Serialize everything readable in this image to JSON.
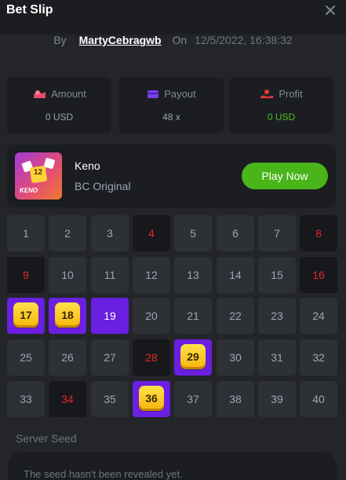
{
  "header": {
    "title": "Bet Slip",
    "close_icon": "close-icon"
  },
  "meta": {
    "by_label": "By",
    "username": "MartyCebragwb",
    "on_label": "On",
    "datetime": "12/5/2022, 16:38:32"
  },
  "stats": [
    {
      "label": "Amount",
      "value": "0 USD",
      "icon": "amount-icon",
      "color": "#e24a6a"
    },
    {
      "label": "Payout",
      "value": "48 x",
      "icon": "payout-icon",
      "color": "#7b3ff2"
    },
    {
      "label": "Profit",
      "value": "0 USD",
      "icon": "profit-icon",
      "color": "#e23a3a",
      "value_color": "#49c31b"
    }
  ],
  "game": {
    "name": "Keno",
    "subtitle": "BC Original",
    "play_label": "Play Now",
    "thumb_label": "KENO",
    "thumb_number": "12"
  },
  "grid": {
    "numbers": [
      "1",
      "2",
      "3",
      "4",
      "5",
      "6",
      "7",
      "8",
      "9",
      "10",
      "11",
      "12",
      "13",
      "14",
      "15",
      "16",
      "17",
      "18",
      "19",
      "20",
      "21",
      "22",
      "23",
      "24",
      "25",
      "26",
      "27",
      "28",
      "29",
      "30",
      "31",
      "32",
      "33",
      "34",
      "35",
      "36",
      "37",
      "38",
      "39",
      "40"
    ],
    "drawn_missed": [
      4,
      8,
      9,
      16,
      28,
      34
    ],
    "picked_hit": [
      17,
      18,
      29,
      36
    ],
    "picked_only": [
      19
    ]
  },
  "seed": {
    "label": "Server Seed",
    "text": "The seed hasn't been revealed yet."
  }
}
